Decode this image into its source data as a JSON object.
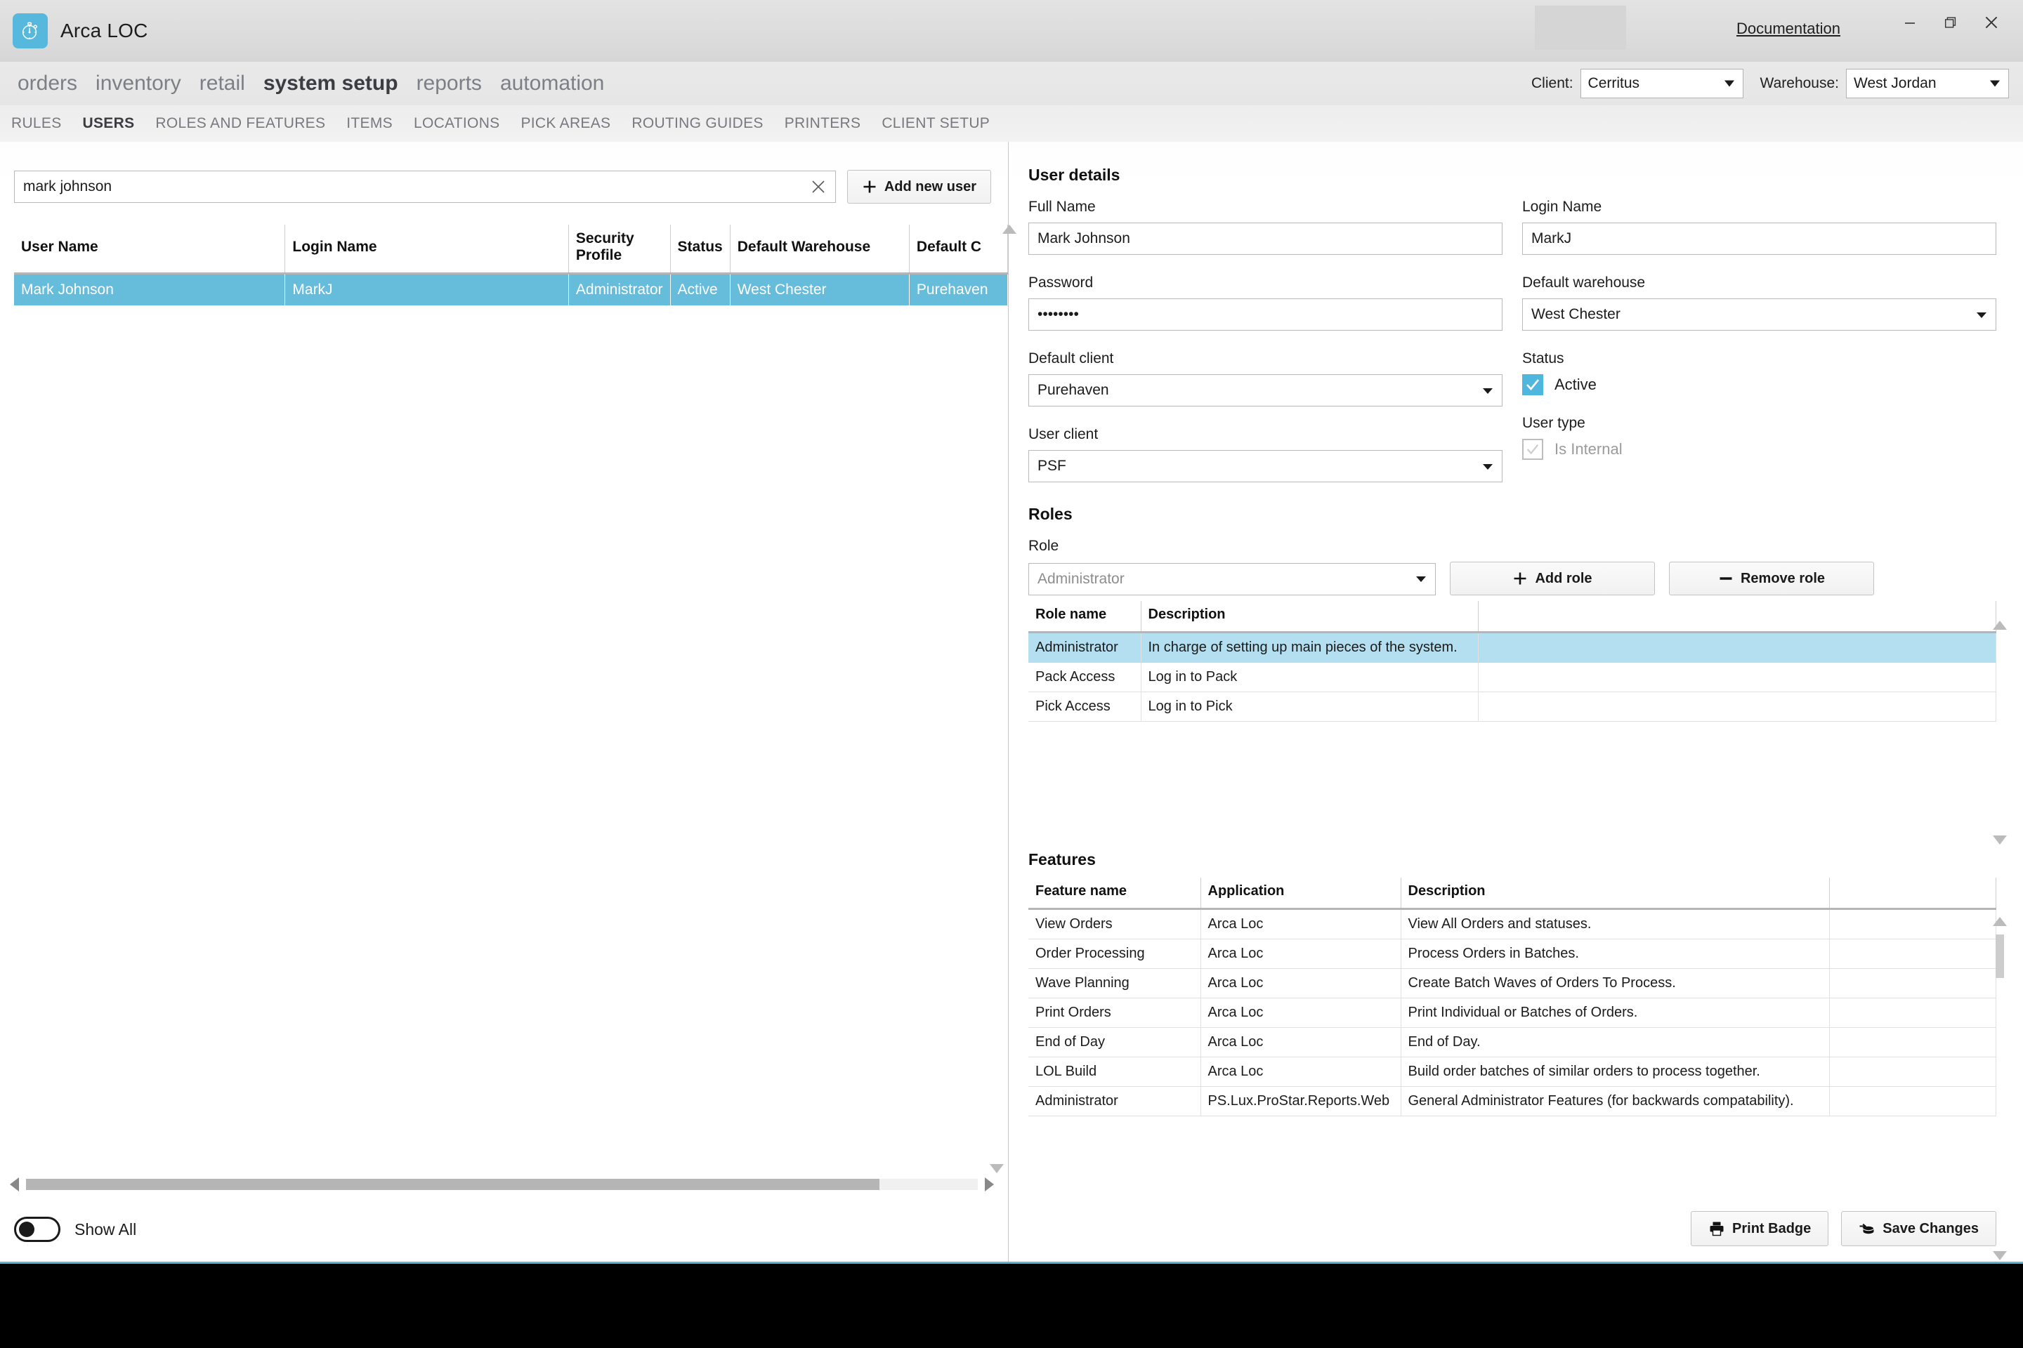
{
  "window": {
    "app_title": "Arca LOC",
    "logo_icon": "compass-icon",
    "documentation_link": "Documentation",
    "minimize_icon": "minimize-icon",
    "restore_icon": "restore-icon",
    "close_icon": "close-icon"
  },
  "header": {
    "client_label": "Client:",
    "client_value": "Cerritus",
    "warehouse_label": "Warehouse:",
    "warehouse_value": "West Jordan"
  },
  "main_nav": [
    {
      "label": "orders",
      "active": false
    },
    {
      "label": "inventory",
      "active": false
    },
    {
      "label": "retail",
      "active": false
    },
    {
      "label": "system setup",
      "active": true
    },
    {
      "label": "reports",
      "active": false
    },
    {
      "label": "automation",
      "active": false
    }
  ],
  "sub_nav": [
    {
      "label": "RULES",
      "active": false
    },
    {
      "label": "USERS",
      "active": true
    },
    {
      "label": "ROLES AND FEATURES",
      "active": false
    },
    {
      "label": "ITEMS",
      "active": false
    },
    {
      "label": "LOCATIONS",
      "active": false
    },
    {
      "label": "PICK AREAS",
      "active": false
    },
    {
      "label": "ROUTING GUIDES",
      "active": false
    },
    {
      "label": "PRINTERS",
      "active": false
    },
    {
      "label": "CLIENT SETUP",
      "active": false
    }
  ],
  "left_pane": {
    "search_value": "mark johnson",
    "search_placeholder": "",
    "clear_icon": "close-icon",
    "add_new_user_label": "Add new user",
    "add_icon": "plus-icon",
    "columns": [
      "User Name",
      "Login Name",
      "Security Profile",
      "Status",
      "Default Warehouse",
      "Default C"
    ],
    "rows": [
      {
        "user_name": "Mark Johnson",
        "login_name": "MarkJ",
        "security_profile": "Administrator",
        "status": "Active",
        "default_warehouse": "West Chester",
        "default_client": "Purehaven",
        "selected": true
      }
    ],
    "show_all_label": "Show All",
    "show_all_on": false
  },
  "user_details": {
    "section_title": "User details",
    "full_name_label": "Full Name",
    "full_name_value": "Mark Johnson",
    "login_name_label": "Login Name",
    "login_name_value": "MarkJ",
    "password_label": "Password",
    "password_value": "••••••••",
    "default_warehouse_label": "Default warehouse",
    "default_warehouse_value": "West Chester",
    "default_client_label": "Default client",
    "default_client_value": "Purehaven",
    "status_label": "Status",
    "status_checkbox_label": "Active",
    "status_checked": true,
    "user_client_label": "User client",
    "user_client_value": "PSF",
    "user_type_label": "User type",
    "user_type_checkbox_label": "Is Internal",
    "user_type_checked": false
  },
  "roles": {
    "section_title": "Roles",
    "role_label": "Role",
    "role_value": "Administrator",
    "add_role_label": "Add role",
    "add_role_icon": "plus-icon",
    "remove_role_label": "Remove role",
    "remove_role_icon": "minus-icon",
    "columns": [
      "Role name",
      "Description",
      ""
    ],
    "rows": [
      {
        "role_name": "Administrator",
        "description": "In charge of setting up main pieces of the system.",
        "selected": true
      },
      {
        "role_name": "Pack Access",
        "description": "Log in to Pack",
        "selected": false
      },
      {
        "role_name": "Pick Access",
        "description": "Log in to Pick",
        "selected": false
      }
    ]
  },
  "features": {
    "section_title": "Features",
    "columns": [
      "Feature name",
      "Application",
      "Description",
      ""
    ],
    "rows": [
      {
        "feature_name": "View Orders",
        "application": "Arca Loc",
        "description": "View All Orders and statuses."
      },
      {
        "feature_name": "Order Processing",
        "application": "Arca Loc",
        "description": "Process Orders in Batches."
      },
      {
        "feature_name": "Wave Planning",
        "application": "Arca Loc",
        "description": "Create Batch Waves of Orders To Process."
      },
      {
        "feature_name": "Print Orders",
        "application": "Arca Loc",
        "description": "Print Individual or Batches of Orders."
      },
      {
        "feature_name": "End of Day",
        "application": "Arca Loc",
        "description": "End of Day."
      },
      {
        "feature_name": "LOL Build",
        "application": "Arca Loc",
        "description": "Build order batches of similar orders to process together."
      },
      {
        "feature_name": "Administrator",
        "application": "PS.Lux.ProStar.Reports.Web",
        "description": "General Administrator Features (for backwards compatability)."
      }
    ]
  },
  "actions": {
    "print_badge_label": "Print Badge",
    "print_icon": "printer-icon",
    "save_changes_label": "Save Changes",
    "save_icon": "database-save-icon"
  },
  "colors": {
    "accent": "#5ab5d6",
    "row_selected": "#65bcdb",
    "row_selected_light": "#b3dff0",
    "checkbox_on": "#4fb6dd"
  }
}
